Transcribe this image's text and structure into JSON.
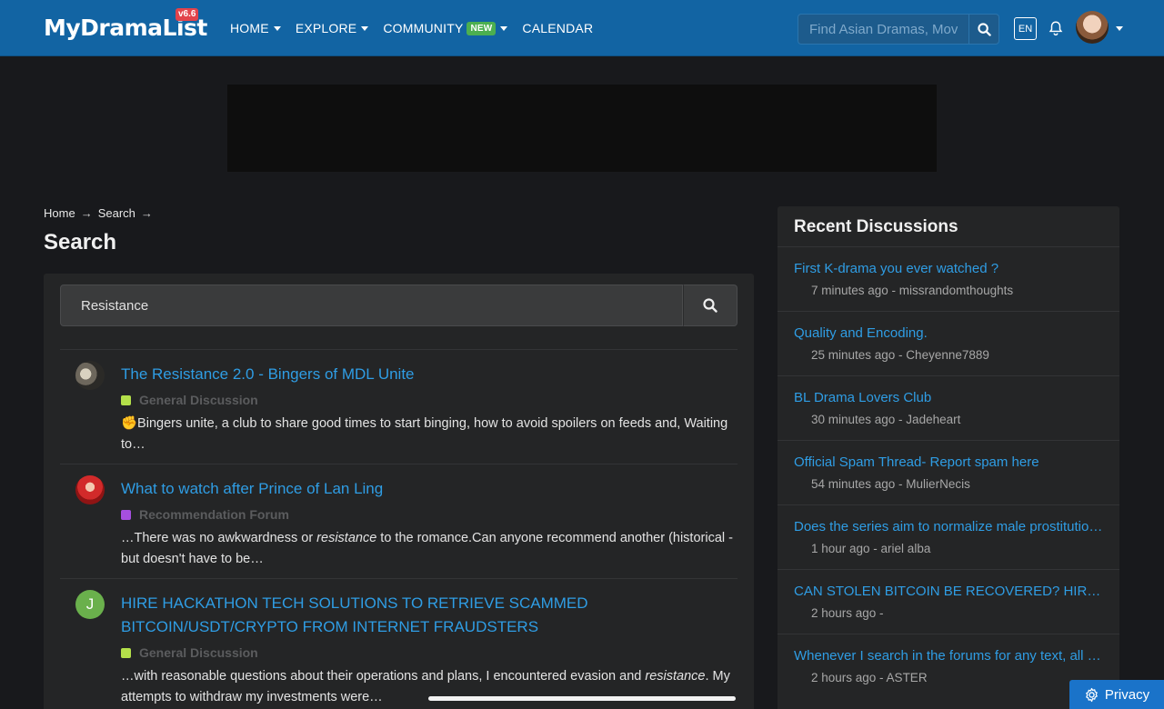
{
  "brand": {
    "name": "MyDramaList",
    "version": "v6.6"
  },
  "nav": {
    "items": [
      {
        "label": "HOME",
        "has_caret": true
      },
      {
        "label": "EXPLORE",
        "has_caret": true
      },
      {
        "label": "COMMUNITY",
        "badge": "NEW",
        "has_caret": true
      },
      {
        "label": "CALENDAR",
        "has_caret": false
      }
    ],
    "search_placeholder": "Find Asian Dramas, Movies",
    "language": "EN"
  },
  "breadcrumb": {
    "home": "Home",
    "current": "Search",
    "sep": "→"
  },
  "page_title": "Search",
  "search": {
    "value": "Resistance"
  },
  "results": [
    {
      "title": "The Resistance 2.0 - Bingers of MDL Unite",
      "category": "General Discussion",
      "category_color": "#b4e04a",
      "snippet": "✊Bingers unite, a club to share good times to start binging, how to avoid spoilers on feeds and, Waiting to…"
    },
    {
      "title": "What to watch after Prince of Lan Ling",
      "category": "Recommendation Forum",
      "category_color": "#a64fe0",
      "snippet_before": "…There was no awkwardness or ",
      "snippet_em": "resistance",
      "snippet_after": " to the romance.Can anyone recommend another (historical - but doesn't have to be…"
    },
    {
      "title": "HIRE HACKATHON TECH SOLUTIONS TO RETRIEVE SCAMMED BITCOIN/USDT/CRYPTO FROM INTERNET FRAUDSTERS",
      "category": "General Discussion",
      "category_color": "#b4e04a",
      "avatar_letter": "J",
      "snippet_before": "…with reasonable questions about their operations and plans, I encountered evasion and ",
      "snippet_em": "resistance",
      "snippet_after": ". My attempts to withdraw my investments were…"
    }
  ],
  "sidebar": {
    "title": "Recent Discussions",
    "items": [
      {
        "title": "First K-drama you ever watched ?",
        "meta": "7 minutes ago - missrandomthoughts"
      },
      {
        "title": "Quality and Encoding.",
        "meta": "25 minutes ago - Cheyenne7889"
      },
      {
        "title": "BL Drama Lovers Club",
        "meta": "30 minutes ago - Jadeheart"
      },
      {
        "title": "Official Spam Thread- Report spam here",
        "meta": "54 minutes ago - MulierNecis"
      },
      {
        "title": "Does the series aim to normalize male prostitution...",
        "meta": "1 hour ago - ariel alba"
      },
      {
        "title": "CAN STOLEN BITCOIN BE RECOVERED? HIRE RECOVERY...",
        "meta": "2 hours ago -"
      },
      {
        "title": "Whenever I search in the forums for any text, all of...",
        "meta": "2 hours ago - ASTER"
      }
    ]
  },
  "privacy": {
    "label": "Privacy"
  },
  "colors": {
    "navbar": "#1264a3",
    "link": "#2f9de4",
    "background": "#18191c",
    "card": "#242526"
  }
}
